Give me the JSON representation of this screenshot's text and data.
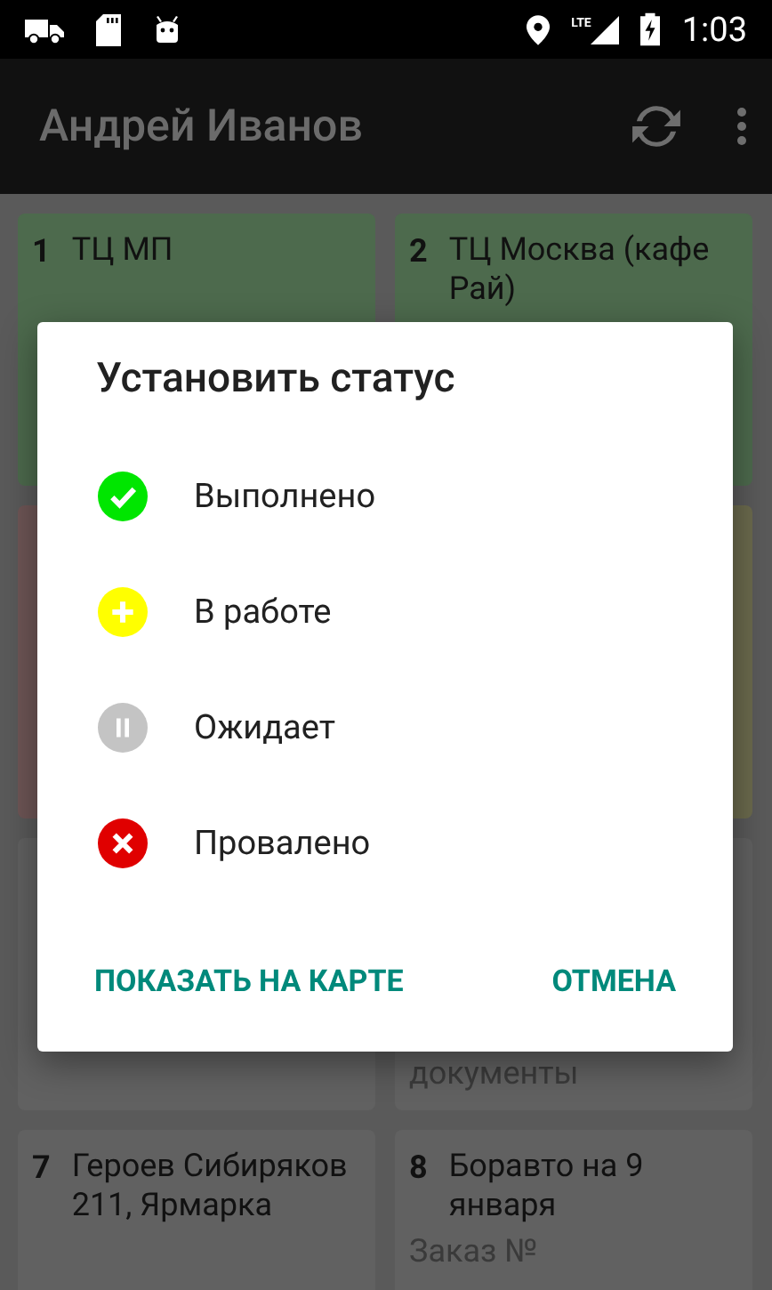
{
  "status_bar": {
    "network": "LTE",
    "time": "1:03"
  },
  "app_bar": {
    "title": "Андрей Иванов"
  },
  "cards": [
    {
      "number": "1",
      "title": "ТЦ МП",
      "color": "#4d6a4d"
    },
    {
      "number": "2",
      "title": "ТЦ Москва (кафе Рай)",
      "color": "#4d6a4d"
    },
    {
      "color": "#6e5656"
    },
    {
      "color": "#6b6a4d"
    },
    {
      "color": "#616161"
    },
    {
      "description": "документы",
      "color": "#616161"
    },
    {
      "number": "7",
      "title": "Героев Сибиряков 211, Ярмарка",
      "color": "#616161"
    },
    {
      "number": "8",
      "title": "Боравто на 9 января",
      "description": "Заказ №",
      "color": "#616161"
    }
  ],
  "dialog": {
    "title": "Установить статус",
    "options": [
      {
        "kind": "done",
        "label": "Выполнено"
      },
      {
        "kind": "progress",
        "label": "В работе"
      },
      {
        "kind": "waiting",
        "label": "Ожидает"
      },
      {
        "kind": "failed",
        "label": "Провалено"
      }
    ],
    "buttons": [
      "ПОКАЗАТЬ НА КАРТЕ",
      "ОТМЕНА"
    ]
  }
}
